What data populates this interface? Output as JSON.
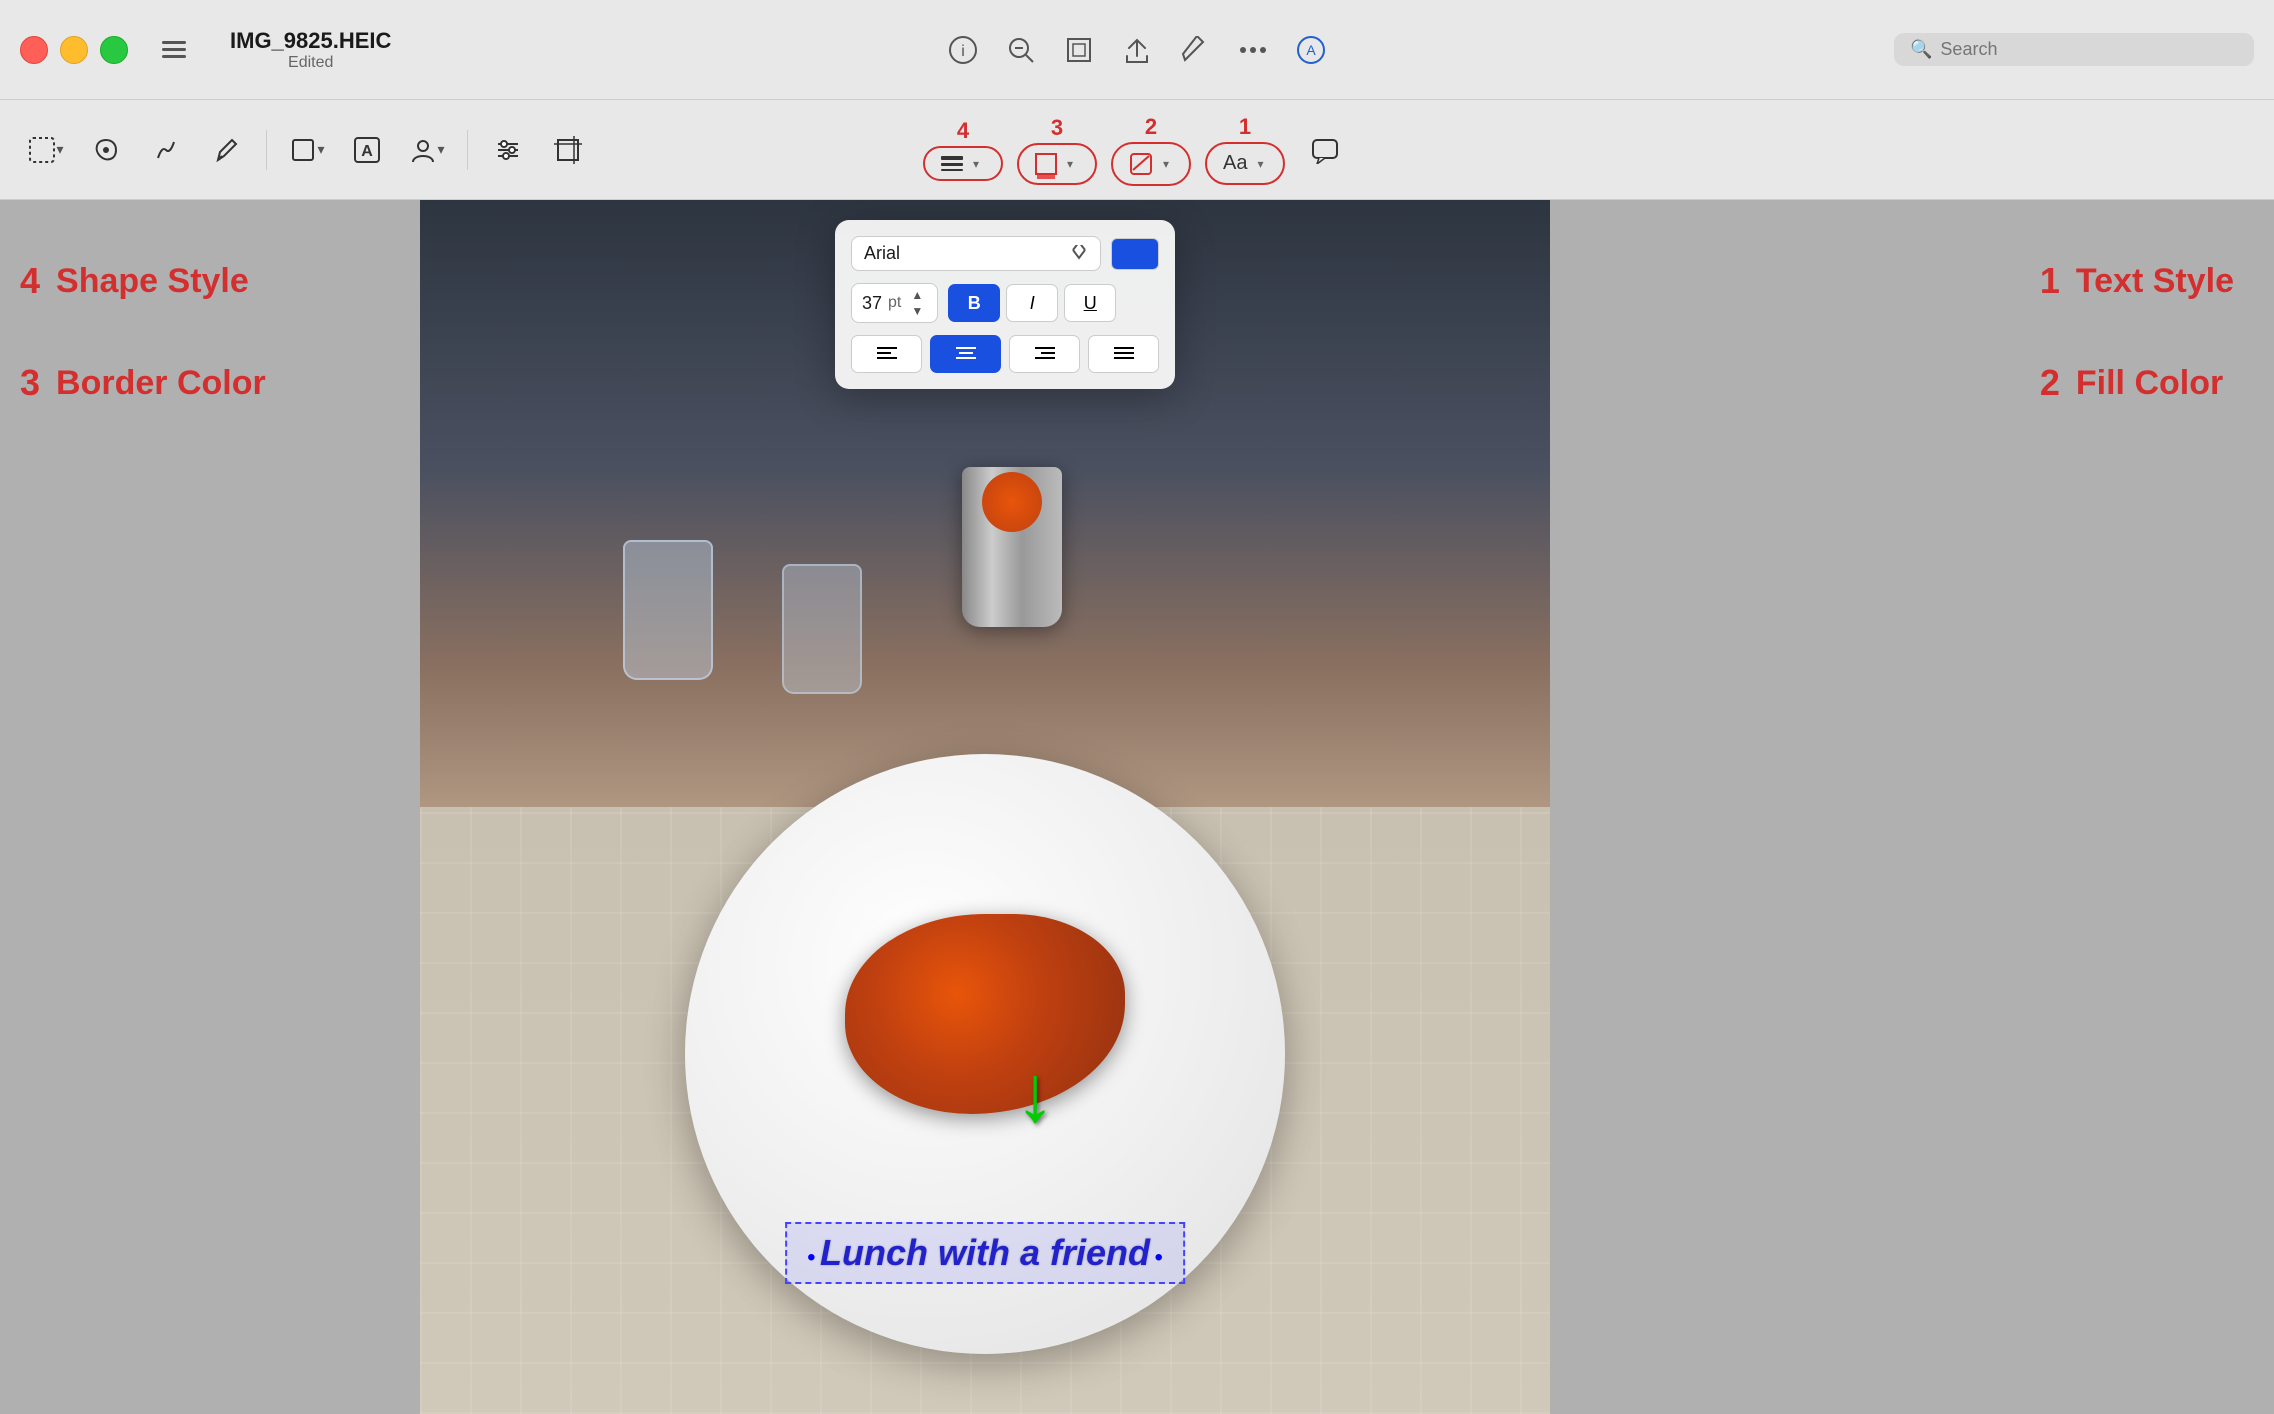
{
  "window": {
    "filename": "IMG_9825.HEIC",
    "subtitle": "Edited"
  },
  "toolbar": {
    "tools": [
      {
        "id": "selection",
        "icon": "⬜",
        "label": "Selection"
      },
      {
        "id": "smart-lasso",
        "icon": "✦",
        "label": "Smart Lasso"
      },
      {
        "id": "sketch",
        "icon": "✏",
        "label": "Sketch"
      },
      {
        "id": "draw",
        "icon": "🖊",
        "label": "Draw"
      },
      {
        "id": "shape",
        "icon": "⧉",
        "label": "Shape"
      },
      {
        "id": "person",
        "icon": "👤",
        "label": "Person"
      },
      {
        "id": "filter",
        "icon": "⚙",
        "label": "Filter"
      },
      {
        "id": "crop",
        "icon": "⊡",
        "label": "Crop"
      },
      {
        "id": "speech",
        "icon": "💬",
        "label": "Speech"
      }
    ]
  },
  "center_tools": {
    "shape_style": {
      "label": "Shape Style",
      "badge": "4"
    },
    "border_color": {
      "label": "Border Color",
      "badge": "3"
    },
    "fill_color": {
      "label": "Fill Color",
      "badge": "2"
    },
    "text_style": {
      "label": "Text Style",
      "badge": "1"
    }
  },
  "annotations_left": [
    {
      "num": "4",
      "label": "Shape Style"
    },
    {
      "num": "3",
      "label": "Border Color"
    }
  ],
  "annotations_right": [
    {
      "num": "1",
      "label": "Text Style"
    },
    {
      "num": "2",
      "label": "Fill Color"
    }
  ],
  "popover": {
    "font": {
      "name": "Arial",
      "size": "37",
      "unit": "pt"
    },
    "color": "#1a50e0",
    "styles": {
      "bold": {
        "label": "B",
        "active": true
      },
      "italic": {
        "label": "I",
        "active": false
      },
      "underline": {
        "label": "U",
        "active": false
      }
    },
    "alignment": {
      "left": {
        "active": false
      },
      "center": {
        "active": true
      },
      "right": {
        "active": false
      },
      "justify": {
        "active": false
      }
    }
  },
  "caption": {
    "text": "Lunch with a friend"
  },
  "search": {
    "placeholder": "Search",
    "value": ""
  },
  "titlebar_right_tools": [
    {
      "id": "info",
      "icon": "ℹ",
      "label": "Info"
    },
    {
      "id": "zoom-out",
      "icon": "🔍",
      "label": "Zoom Out"
    },
    {
      "id": "share",
      "icon": "⬆",
      "label": "Share"
    },
    {
      "id": "markup",
      "icon": "✏",
      "label": "Markup"
    }
  ]
}
